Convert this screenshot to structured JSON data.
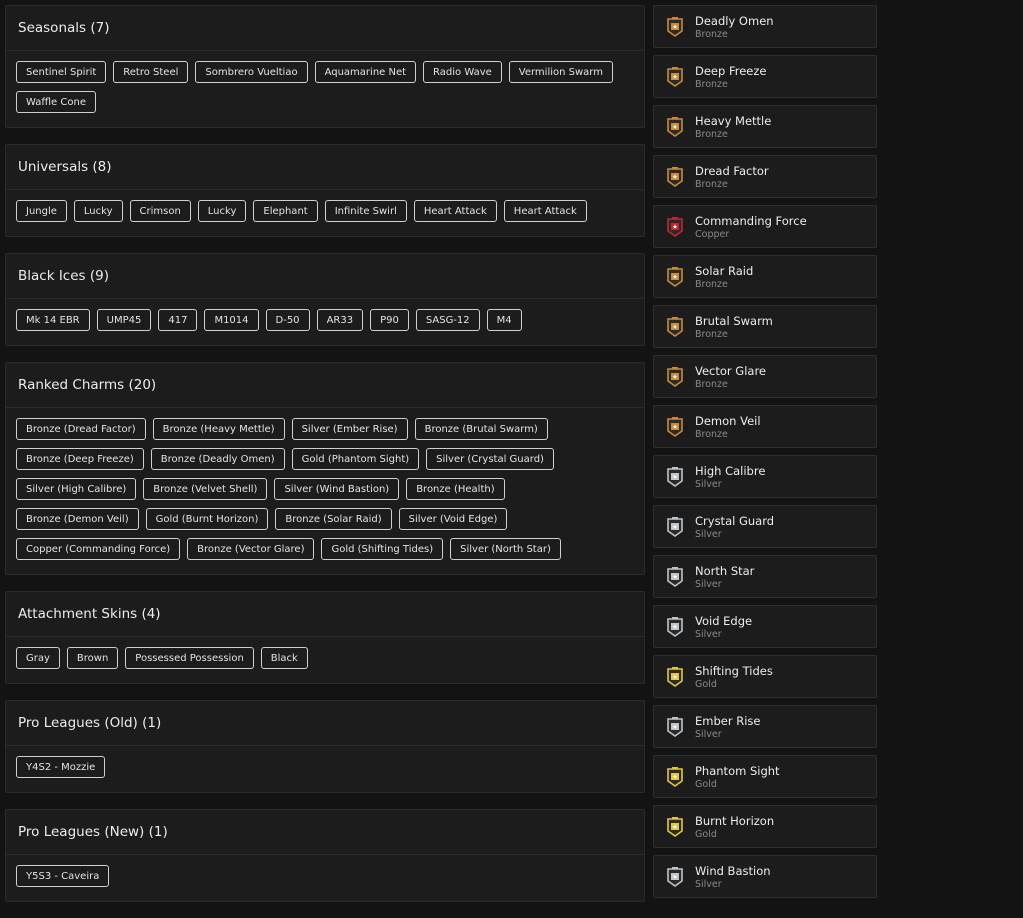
{
  "sections": [
    {
      "title": "Seasonals (7)",
      "items": [
        "Sentinel Spirit",
        "Retro Steel",
        "Sombrero Vueltiao",
        "Aquamarine Net",
        "Radio Wave",
        "Vermilion Swarm",
        "Waffle Cone"
      ]
    },
    {
      "title": "Universals (8)",
      "items": [
        "Jungle",
        "Lucky",
        "Crimson",
        "Lucky",
        "Elephant",
        "Infinite Swirl",
        "Heart Attack",
        "Heart Attack"
      ]
    },
    {
      "title": "Black Ices (9)",
      "items": [
        "Mk 14 EBR",
        "UMP45",
        "417",
        "M1014",
        "D-50",
        "AR33",
        "P90",
        "SASG-12",
        "M4"
      ]
    },
    {
      "title": "Ranked Charms (20)",
      "items": [
        "Bronze (Dread Factor)",
        "Bronze (Heavy Mettle)",
        "Silver (Ember Rise)",
        "Bronze (Brutal Swarm)",
        "Bronze (Deep Freeze)",
        "Bronze (Deadly Omen)",
        "Gold (Phantom Sight)",
        "Silver (Crystal Guard)",
        "Silver (High Calibre)",
        "Bronze (Velvet Shell)",
        "Silver (Wind Bastion)",
        "Bronze (Health)",
        "Bronze (Demon Veil)",
        "Gold (Burnt Horizon)",
        "Bronze (Solar Raid)",
        "Silver (Void Edge)",
        "Copper (Commanding Force)",
        "Bronze (Vector Glare)",
        "Gold (Shifting Tides)",
        "Silver (North Star)"
      ]
    },
    {
      "title": "Attachment Skins (4)",
      "items": [
        "Gray",
        "Brown",
        "Possessed Possession",
        "Black"
      ]
    },
    {
      "title": "Pro Leagues (Old) (1)",
      "items": [
        "Y4S2 - Mozzie"
      ]
    },
    {
      "title": "Pro Leagues (New) (1)",
      "items": [
        "Y5S3 - Caveira"
      ]
    }
  ],
  "ranks": [
    {
      "name": "Deadly Omen",
      "tier": "Bronze",
      "color": "#c98a3c"
    },
    {
      "name": "Deep Freeze",
      "tier": "Bronze",
      "color": "#c98a3c"
    },
    {
      "name": "Heavy Mettle",
      "tier": "Bronze",
      "color": "#c98a3c"
    },
    {
      "name": "Dread Factor",
      "tier": "Bronze",
      "color": "#c98a3c"
    },
    {
      "name": "Commanding Force",
      "tier": "Copper",
      "color": "#c0262d"
    },
    {
      "name": "Solar Raid",
      "tier": "Bronze",
      "color": "#c98a3c"
    },
    {
      "name": "Brutal Swarm",
      "tier": "Bronze",
      "color": "#c98a3c"
    },
    {
      "name": "Vector Glare",
      "tier": "Bronze",
      "color": "#c98a3c"
    },
    {
      "name": "Demon Veil",
      "tier": "Bronze",
      "color": "#c98a3c"
    },
    {
      "name": "High Calibre",
      "tier": "Silver",
      "color": "#bfc4c8"
    },
    {
      "name": "Crystal Guard",
      "tier": "Silver",
      "color": "#bfc4c8"
    },
    {
      "name": "North Star",
      "tier": "Silver",
      "color": "#bfc4c8"
    },
    {
      "name": "Void Edge",
      "tier": "Silver",
      "color": "#bfc4c8"
    },
    {
      "name": "Shifting Tides",
      "tier": "Gold",
      "color": "#e3c640"
    },
    {
      "name": "Ember Rise",
      "tier": "Silver",
      "color": "#bfc4c8"
    },
    {
      "name": "Phantom Sight",
      "tier": "Gold",
      "color": "#e3c640"
    },
    {
      "name": "Burnt Horizon",
      "tier": "Gold",
      "color": "#e3c640"
    },
    {
      "name": "Wind Bastion",
      "tier": "Silver",
      "color": "#bfc4c8"
    }
  ],
  "icon": "rank-badge-icon"
}
